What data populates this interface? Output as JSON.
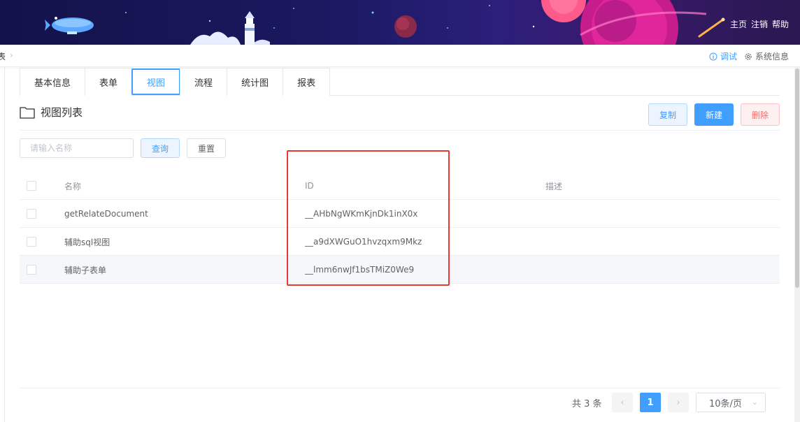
{
  "header": {
    "links": [
      "主页",
      "注销",
      "帮助"
    ]
  },
  "breadcrumb": {
    "current": "表",
    "separator": "›",
    "right": {
      "debug_label": "调试",
      "sysinfo_label": "系统信息"
    }
  },
  "tabs": [
    {
      "label": "基本信息",
      "active": false
    },
    {
      "label": "表单",
      "active": false
    },
    {
      "label": "视图",
      "active": true
    },
    {
      "label": "流程",
      "active": false
    },
    {
      "label": "统计图",
      "active": false
    },
    {
      "label": "报表",
      "active": false
    }
  ],
  "section": {
    "title": "视图列表",
    "buttons": {
      "copy": "复制",
      "new": "新建",
      "delete": "删除"
    }
  },
  "search": {
    "placeholder": "请输入名称",
    "value": "",
    "query_label": "查询",
    "reset_label": "重置"
  },
  "table": {
    "columns": {
      "name": "名称",
      "id": "ID",
      "desc": "描述"
    },
    "rows": [
      {
        "name": "getRelateDocument",
        "id": "__AHbNgWKmKjnDk1inX0x",
        "desc": "",
        "highlighted": false
      },
      {
        "name": "辅助sql视图",
        "id": "__a9dXWGuO1hvzqxm9Mkz",
        "desc": "",
        "highlighted": false
      },
      {
        "name": "辅助子表单",
        "id": "__lmm6nwJf1bsTMiZ0We9",
        "desc": "",
        "highlighted": true
      }
    ]
  },
  "pagination": {
    "total_text": "共 3 条",
    "prev": "‹",
    "current_page": "1",
    "next": "›",
    "page_size": "10条/页"
  },
  "colors": {
    "primary": "#409eff",
    "danger": "#f56c6c",
    "highlight_box": "#e53935"
  }
}
